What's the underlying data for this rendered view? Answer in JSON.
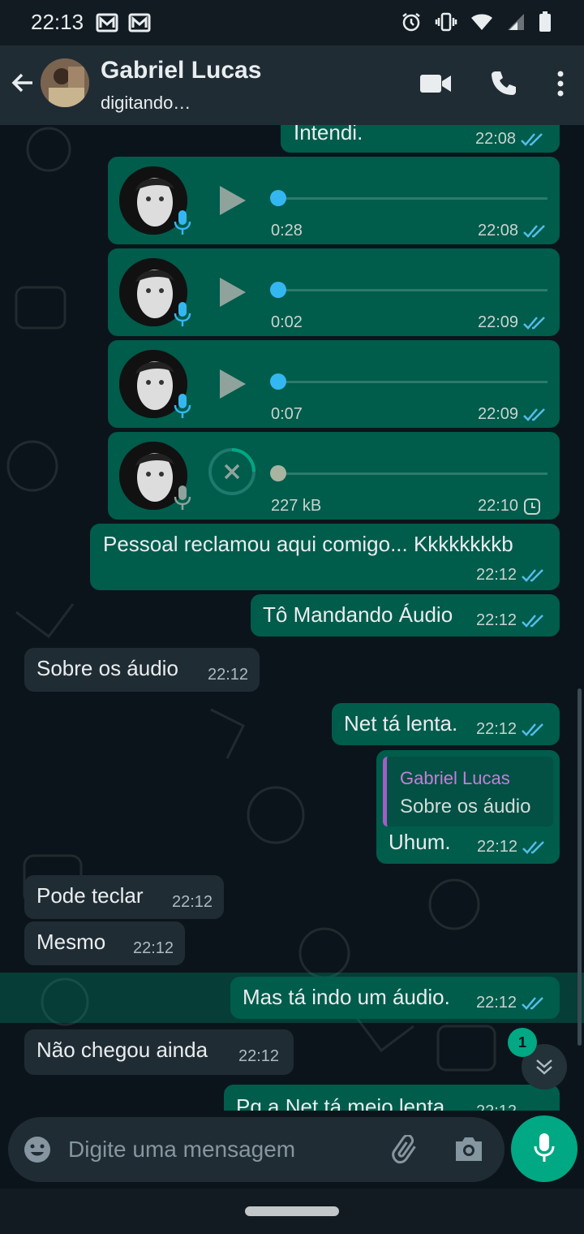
{
  "status_bar": {
    "time": "22:13",
    "battery": "67"
  },
  "header": {
    "contact_name": "Gabriel Lucas",
    "contact_status": "digitando…"
  },
  "messages": [
    {
      "text": "Intendi.",
      "time": "22:08"
    },
    {
      "duration": "0:28",
      "time": "22:08"
    },
    {
      "duration": "0:02",
      "time": "22:09"
    },
    {
      "duration": "0:07",
      "time": "22:09"
    },
    {
      "size": "227 kB",
      "time": "22:10"
    },
    {
      "text": "Pessoal reclamou aqui comigo... Kkkkkkkkb",
      "time": "22:12"
    },
    {
      "text": "Tô Mandando Áudio",
      "time": "22:12"
    },
    {
      "text": "Sobre os áudio",
      "time": "22:12"
    },
    {
      "text": "Net tá lenta.",
      "time": "22:12"
    },
    {
      "quote_name": "Gabriel Lucas",
      "quote_text": "Sobre os áudio",
      "text": "Uhum.",
      "time": "22:12"
    },
    {
      "text": "Pode teclar",
      "time": "22:12"
    },
    {
      "text": "Mesmo",
      "time": "22:12"
    },
    {
      "text": "Mas tá indo um áudio.",
      "time": "22:12"
    },
    {
      "text": "Não chegou ainda",
      "time": "22:12"
    },
    {
      "text": "Pq a Net tá meio lenta",
      "time": "22:12"
    }
  ],
  "unread_badge": "1",
  "input": {
    "placeholder": "Digite uma mensagem"
  },
  "colors": {
    "outgoing": "#005c4b",
    "incoming": "#202c33",
    "accent": "#00a884",
    "read_ticks": "#53bdeb"
  }
}
